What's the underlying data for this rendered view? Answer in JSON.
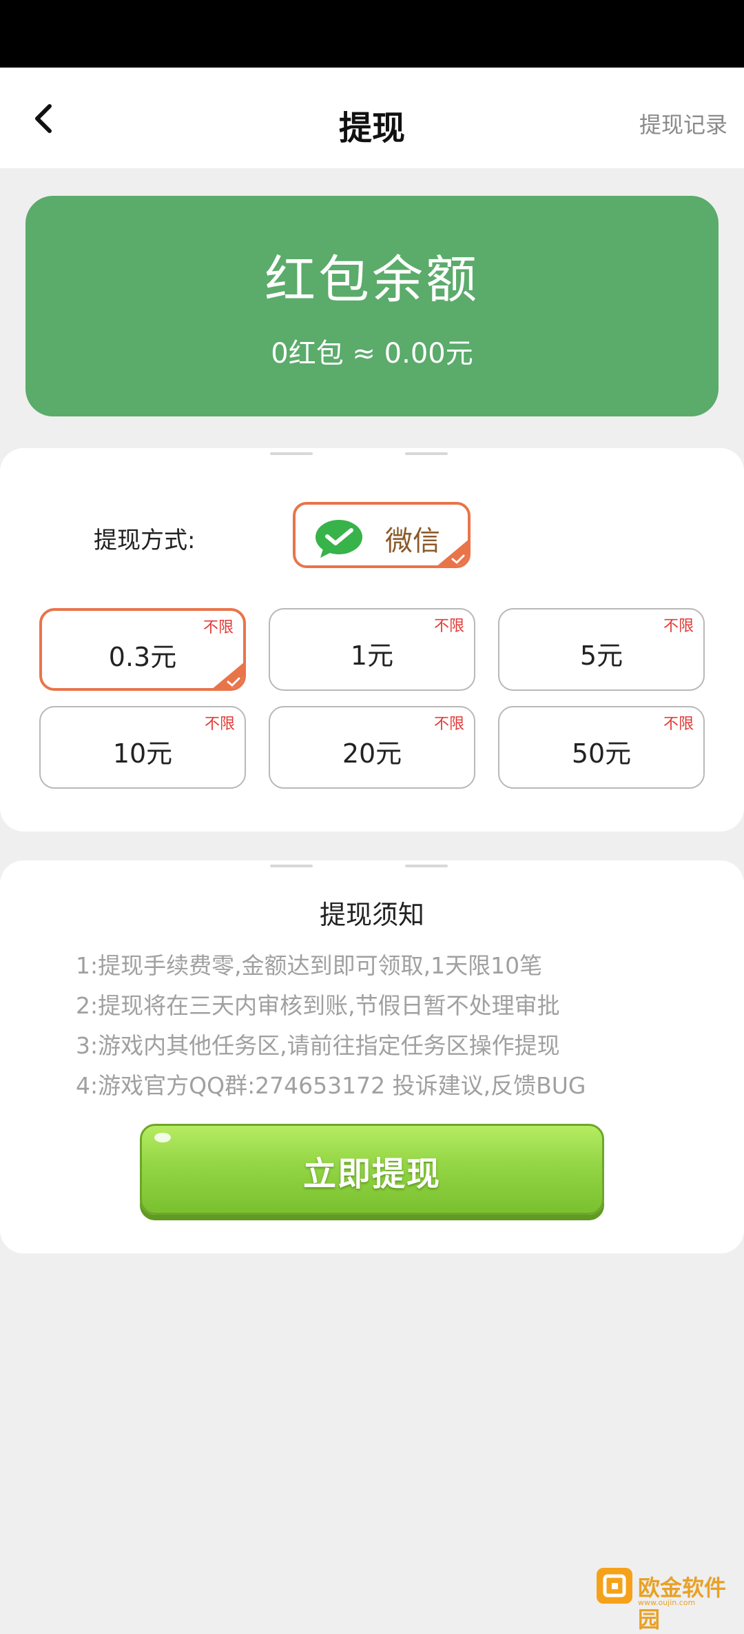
{
  "nav": {
    "title": "提现",
    "right_link": "提现记录"
  },
  "balance": {
    "title": "红包余额",
    "summary": "0红包 ≈ 0.00元"
  },
  "withdraw": {
    "method_label": "提现方式:",
    "method": {
      "name": "微信",
      "icon": "wechat-icon",
      "selected": true
    },
    "options": [
      {
        "value": "0.3元",
        "tag": "不限",
        "selected": true
      },
      {
        "value": "1元",
        "tag": "不限",
        "selected": false
      },
      {
        "value": "5元",
        "tag": "不限",
        "selected": false
      },
      {
        "value": "10元",
        "tag": "不限",
        "selected": false
      },
      {
        "value": "20元",
        "tag": "不限",
        "selected": false
      },
      {
        "value": "50元",
        "tag": "不限",
        "selected": false
      }
    ]
  },
  "notice": {
    "title": "提现须知",
    "lines": [
      "1:提现手续费零,金额达到即可领取,1天限10笔",
      "2:提现将在三天内审核到账,节假日暂不处理审批",
      "3:游戏内其他任务区,请前往指定任务区操作提现",
      "4:游戏官方QQ群:274653172 投诉建议,反馈BUG"
    ],
    "submit_label": "立即提现"
  },
  "watermark": {
    "text": "欧金软件园",
    "url": "www.oujin.com"
  },
  "colors": {
    "brand_green": "#5bab6b",
    "accent_orange": "#e9744a",
    "tag_red": "#e23a36",
    "button_green": "#93d545"
  }
}
